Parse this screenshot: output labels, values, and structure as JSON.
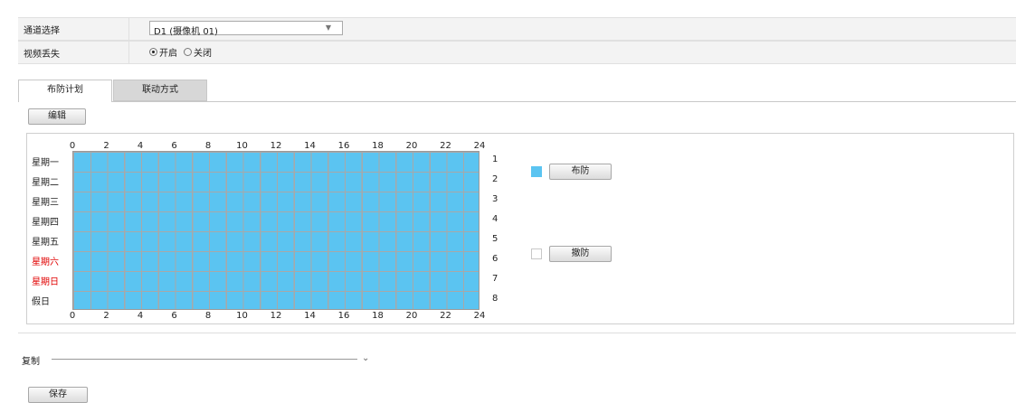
{
  "form": {
    "channel_label": "通道选择",
    "channel_value": "D1 (摄像机 01)",
    "video_loss_label": "视频丢失",
    "video_loss_on": "开启",
    "video_loss_off": "关闭"
  },
  "tabs": [
    "布防计划",
    "联动方式"
  ],
  "edit_button": "编辑",
  "schedule": {
    "hours_top": [
      "0",
      "2",
      "4",
      "6",
      "8",
      "10",
      "12",
      "14",
      "16",
      "18",
      "20",
      "22",
      "24"
    ],
    "hours_bottom": [
      "0",
      "2",
      "4",
      "6",
      "8",
      "10",
      "12",
      "14",
      "16",
      "18",
      "20",
      "22",
      "24"
    ],
    "days": [
      "星期一",
      "星期二",
      "星期三",
      "星期四",
      "星期五",
      "星期六",
      "星期日",
      "假日"
    ],
    "row_numbers": [
      "1",
      "2",
      "3",
      "4",
      "5",
      "6",
      "7",
      "8"
    ],
    "weekend_color": "#e00000",
    "armed_color": "#5bc4f1",
    "armed_fraction": 1
  },
  "legend": {
    "arm_label": "布防",
    "disarm_label": "撤防"
  },
  "copy_label": "复制",
  "save_button": "保存"
}
